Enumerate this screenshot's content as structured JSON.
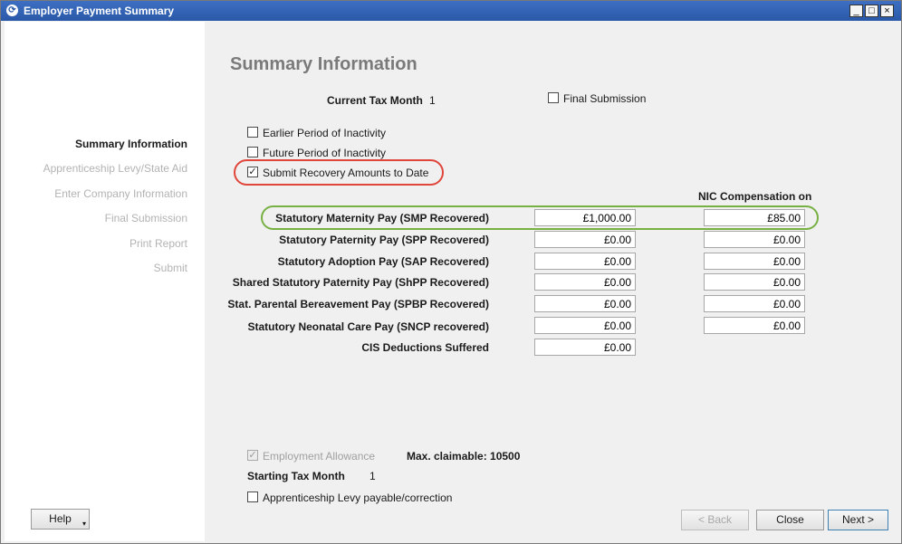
{
  "window": {
    "title": "Employer Payment Summary",
    "minimize": "_",
    "maximize": "□",
    "close": "×"
  },
  "sidebar": {
    "items": [
      {
        "label": "Summary Information",
        "active": true
      },
      {
        "label": "Apprenticeship Levy/State Aid",
        "active": false
      },
      {
        "label": "Enter Company Information",
        "active": false
      },
      {
        "label": "Final Submission",
        "active": false
      },
      {
        "label": "Print Report",
        "active": false
      },
      {
        "label": "Submit",
        "active": false
      }
    ],
    "help_button": "Help"
  },
  "main": {
    "heading": "Summary Information",
    "current_tax_month_label": "Current Tax Month",
    "current_tax_month_value": "1",
    "final_submission": {
      "label": "Final Submission",
      "checked": false
    },
    "checkboxes": [
      {
        "label": "Earlier Period of Inactivity",
        "checked": false
      },
      {
        "label": "Future Period of Inactivity",
        "checked": false
      },
      {
        "label": "Submit Recovery Amounts to Date",
        "checked": true
      }
    ],
    "nic_compensation_header": "NIC Compensation on",
    "recovery_rows": [
      {
        "label": "Statutory Maternity Pay (SMP Recovered)",
        "amount": "£1,000.00",
        "nic": "£85.00"
      },
      {
        "label": "Statutory Paternity Pay (SPP Recovered)",
        "amount": "£0.00",
        "nic": "£0.00"
      },
      {
        "label": "Statutory Adoption Pay (SAP Recovered)",
        "amount": "£0.00",
        "nic": "£0.00"
      },
      {
        "label": "Shared Statutory Paternity Pay (ShPP Recovered)",
        "amount": "£0.00",
        "nic": "£0.00"
      },
      {
        "label": "Stat. Parental Bereavement Pay (SPBP Recovered)",
        "amount": "£0.00",
        "nic": "£0.00"
      },
      {
        "label": "Statutory Neonatal Care Pay (SNCP recovered)",
        "amount": "£0.00",
        "nic": "£0.00"
      }
    ],
    "cis": {
      "label": "CIS Deductions Suffered",
      "amount": "£0.00"
    },
    "employment_allowance": {
      "label": "Employment Allowance",
      "checked": true,
      "disabled": true
    },
    "max_claimable": "Max. claimable: 10500",
    "starting_tax_month_label": "Starting Tax Month",
    "starting_tax_month_value": "1",
    "apprenticeship_levy": {
      "label": "Apprenticeship Levy payable/correction",
      "checked": false
    }
  },
  "buttons": {
    "back": "< Back",
    "close": "Close",
    "next": "Next >"
  },
  "colors": {
    "titlebar": "#2a58a8",
    "highlight_red": "#e0453a",
    "highlight_green": "#77b043"
  }
}
